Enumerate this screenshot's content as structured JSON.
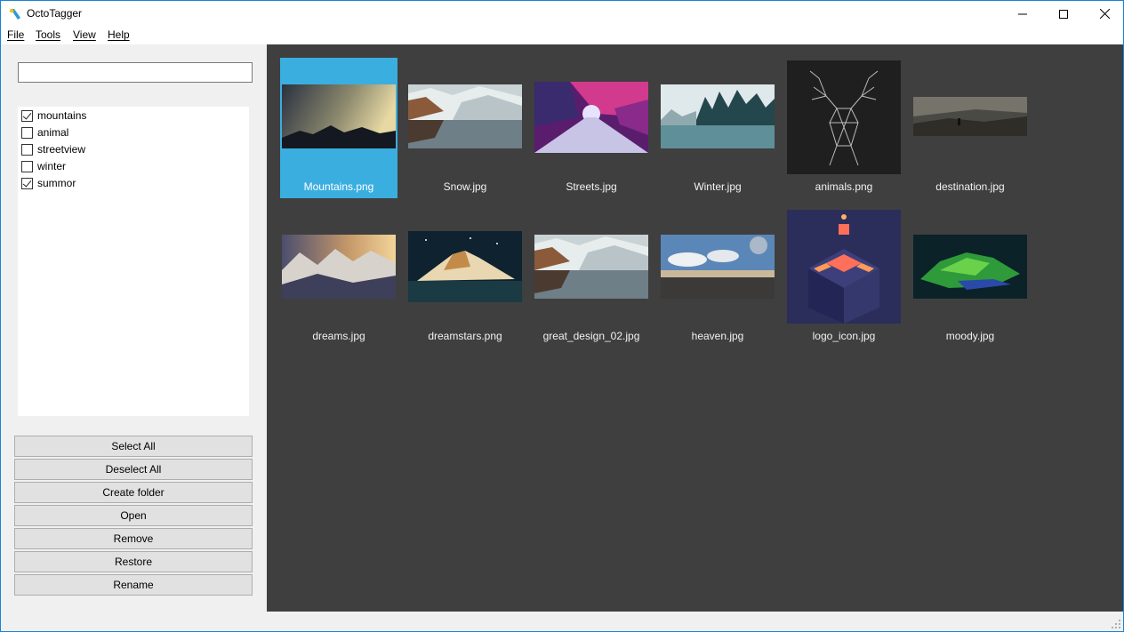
{
  "window": {
    "title": "OctoTagger"
  },
  "menu": [
    {
      "label": "File"
    },
    {
      "label": "Tools"
    },
    {
      "label": "View"
    },
    {
      "label": "Help"
    }
  ],
  "search": {
    "value": "",
    "placeholder": ""
  },
  "tags": [
    {
      "label": "mountains",
      "checked": true
    },
    {
      "label": "animal",
      "checked": false
    },
    {
      "label": "streetview",
      "checked": false
    },
    {
      "label": "winter",
      "checked": false
    },
    {
      "label": "summor",
      "checked": true
    }
  ],
  "buttons": {
    "select_all": "Select All",
    "deselect_all": "Deselect All",
    "create_folder": "Create folder",
    "open": "Open",
    "remove": "Remove",
    "restore": "Restore",
    "rename": "Rename"
  },
  "files": [
    {
      "name": "Mountains.png",
      "selected": true
    },
    {
      "name": "Snow.jpg",
      "selected": false
    },
    {
      "name": "Streets.jpg",
      "selected": false
    },
    {
      "name": "Winter.jpg",
      "selected": false
    },
    {
      "name": "animals.png",
      "selected": false
    },
    {
      "name": "destination.jpg",
      "selected": false
    },
    {
      "name": "dreams.jpg",
      "selected": false
    },
    {
      "name": "dreamstars.png",
      "selected": false
    },
    {
      "name": "great_design_02.jpg",
      "selected": false
    },
    {
      "name": "heaven.jpg",
      "selected": false
    },
    {
      "name": "logo_icon.jpg",
      "selected": false
    },
    {
      "name": "moody.jpg",
      "selected": false
    }
  ],
  "colors": {
    "selection": "#3baee0",
    "gallery_background": "#3f3f3f",
    "window_border": "#1883d7"
  }
}
